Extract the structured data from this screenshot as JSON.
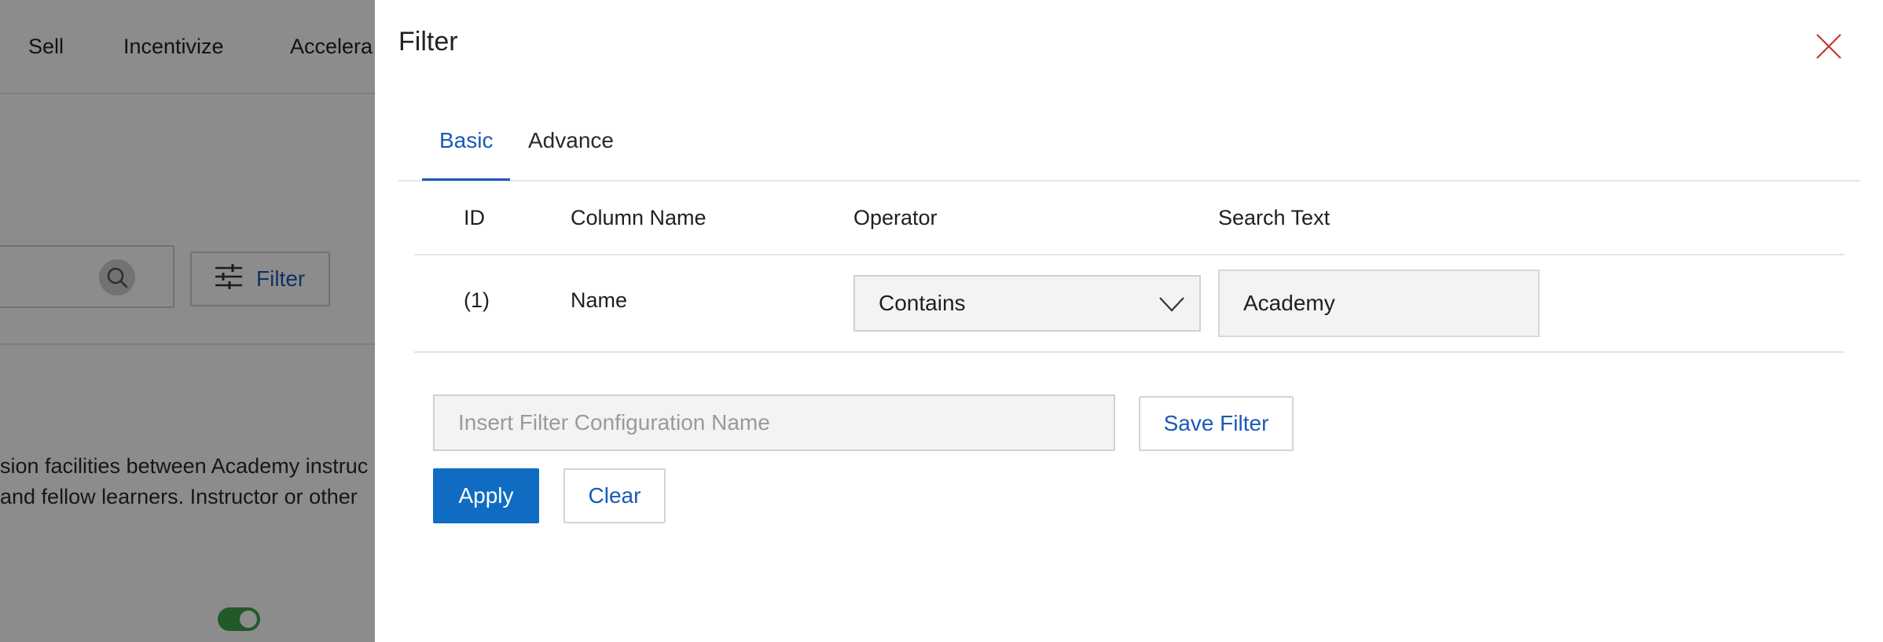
{
  "background": {
    "nav_items": [
      "Sell",
      "Incentivize",
      "Accelera"
    ],
    "filter_button_label": "Filter",
    "description_lines": [
      "sion facilities between Academy instruc",
      "and fellow learners. Instructor or other"
    ]
  },
  "drawer": {
    "title": "Filter",
    "tabs": [
      {
        "label": "Basic",
        "active": true
      },
      {
        "label": "Advance",
        "active": false
      }
    ],
    "table": {
      "headers": {
        "id": "ID",
        "column_name": "Column Name",
        "operator": "Operator",
        "search_text": "Search Text"
      },
      "rows": [
        {
          "id": "(1)",
          "column_name": "Name",
          "operator": "Contains",
          "search_text": "Academy"
        }
      ]
    },
    "config_name": {
      "value": "",
      "placeholder": "Insert Filter Configuration Name"
    },
    "buttons": {
      "save_filter": "Save Filter",
      "apply": "Apply",
      "clear": "Clear"
    }
  },
  "colors": {
    "accent": "#1a5ab8",
    "primary_button": "#0f6cc2",
    "close_icon": "#c0392b",
    "toggle_on": "#3fa34d"
  },
  "icons": {
    "close": "close-icon",
    "chevron": "chevron-down-icon",
    "search": "search-icon",
    "filter": "sliders-icon"
  }
}
